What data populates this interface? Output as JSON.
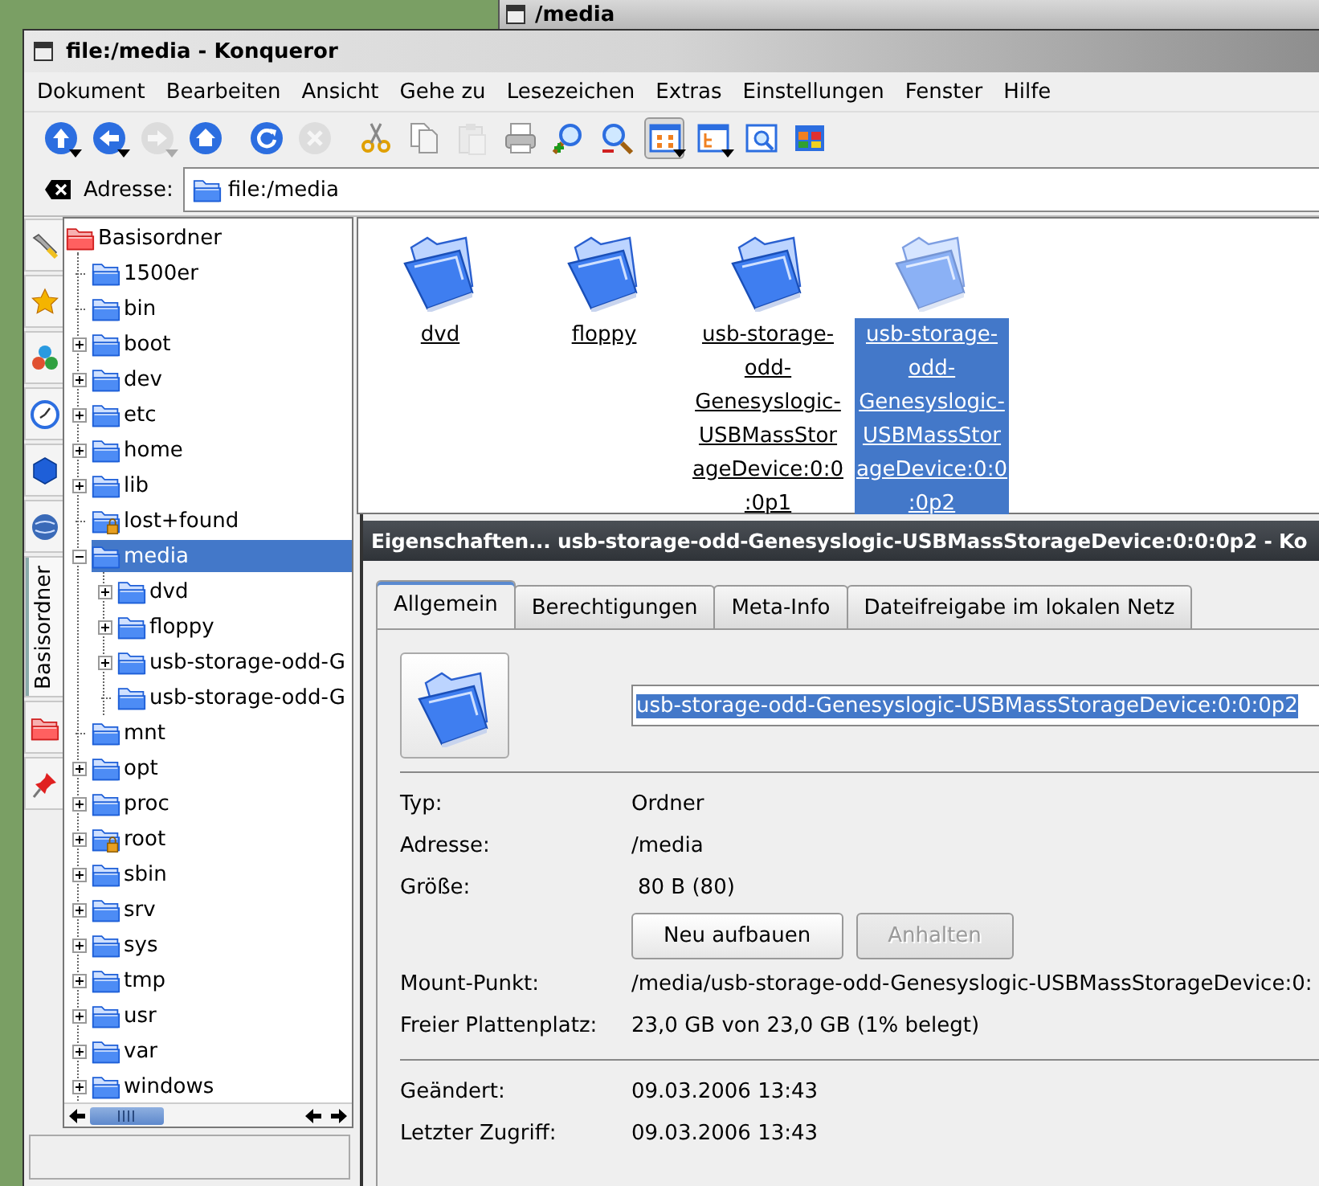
{
  "background_window": {
    "title": "/media"
  },
  "window": {
    "title": "file:/media - Konqueror"
  },
  "menu": [
    "Dokument",
    "Bearbeiten",
    "Ansicht",
    "Gehe zu",
    "Lesezeichen",
    "Extras",
    "Einstellungen",
    "Fenster",
    "Hilfe"
  ],
  "toolbar": [
    {
      "kind": "up",
      "dropdown": true,
      "disabled": false,
      "pressed": false
    },
    {
      "kind": "back",
      "dropdown": true,
      "disabled": false,
      "pressed": false
    },
    {
      "kind": "forward",
      "dropdown": true,
      "disabled": true,
      "pressed": false
    },
    {
      "kind": "home",
      "dropdown": false,
      "disabled": false,
      "pressed": false
    },
    {
      "kind": "reload",
      "dropdown": false,
      "disabled": false,
      "pressed": false
    },
    {
      "kind": "stop",
      "dropdown": false,
      "disabled": true,
      "pressed": false
    },
    {
      "kind": "cut",
      "dropdown": false,
      "disabled": false,
      "pressed": false
    },
    {
      "kind": "copy",
      "dropdown": false,
      "disabled": false,
      "pressed": false
    },
    {
      "kind": "paste",
      "dropdown": false,
      "disabled": true,
      "pressed": false
    },
    {
      "kind": "print",
      "dropdown": false,
      "disabled": false,
      "pressed": false
    },
    {
      "kind": "zoom-in",
      "dropdown": false,
      "disabled": false,
      "pressed": false
    },
    {
      "kind": "zoom-out",
      "dropdown": false,
      "disabled": false,
      "pressed": false
    },
    {
      "kind": "icon-view",
      "dropdown": true,
      "disabled": false,
      "pressed": true
    },
    {
      "kind": "tree-view",
      "dropdown": true,
      "disabled": false,
      "pressed": false
    },
    {
      "kind": "preview",
      "dropdown": false,
      "disabled": false,
      "pressed": false
    },
    {
      "kind": "color-grid",
      "dropdown": false,
      "disabled": false,
      "pressed": false
    }
  ],
  "address": {
    "label": "Adresse:",
    "value": "file:/media"
  },
  "sidebar_tabs": [
    {
      "kind": "wrench",
      "selected": false
    },
    {
      "kind": "star",
      "selected": false
    },
    {
      "kind": "balls",
      "selected": false
    },
    {
      "kind": "clock",
      "selected": false
    },
    {
      "kind": "cube",
      "selected": false
    },
    {
      "kind": "globe",
      "selected": false
    },
    {
      "kind": "text",
      "label": "Basisordner",
      "selected": true
    },
    {
      "kind": "red-folder",
      "selected": false
    },
    {
      "kind": "pin",
      "selected": false
    }
  ],
  "tree": {
    "label": "Basisordner",
    "kind": "root",
    "selected": false,
    "children": [
      {
        "label": "1500er",
        "selected": false
      },
      {
        "label": "bin",
        "selected": false
      },
      {
        "label": "boot",
        "expanded": false,
        "selected": false
      },
      {
        "label": "dev",
        "expanded": false,
        "selected": false
      },
      {
        "label": "etc",
        "expanded": false,
        "selected": false
      },
      {
        "label": "home",
        "expanded": false,
        "selected": false
      },
      {
        "label": "lib",
        "expanded": false,
        "selected": false
      },
      {
        "label": "lost+found",
        "locked": true,
        "selected": false
      },
      {
        "label": "media",
        "expanded": true,
        "selected": true,
        "children": [
          {
            "label": "dvd",
            "expanded": false,
            "selected": false
          },
          {
            "label": "floppy",
            "expanded": false,
            "selected": false
          },
          {
            "label": "usb-storage-odd-G",
            "expanded": false,
            "selected": false
          },
          {
            "label": "usb-storage-odd-G",
            "selected": false
          }
        ]
      },
      {
        "label": "mnt",
        "selected": false
      },
      {
        "label": "opt",
        "expanded": false,
        "selected": false
      },
      {
        "label": "proc",
        "expanded": false,
        "selected": false
      },
      {
        "label": "root",
        "expanded": false,
        "locked": true,
        "selected": false
      },
      {
        "label": "sbin",
        "expanded": false,
        "selected": false
      },
      {
        "label": "srv",
        "expanded": false,
        "selected": false
      },
      {
        "label": "sys",
        "expanded": false,
        "selected": false
      },
      {
        "label": "tmp",
        "expanded": false,
        "selected": false
      },
      {
        "label": "usr",
        "expanded": false,
        "selected": false
      },
      {
        "label": "var",
        "expanded": false,
        "selected": false
      },
      {
        "label": "windows",
        "expanded": false,
        "selected": false
      }
    ]
  },
  "icons": [
    {
      "label": "dvd",
      "selected": false
    },
    {
      "label": "floppy",
      "selected": false
    },
    {
      "label": "usb-storage-odd-Genesyslogic-USBMassStorageDevice:0:0:0p1",
      "selected": false
    },
    {
      "label": "usb-storage-odd-Genesyslogic-USBMassStorageDevice:0:0:0p2",
      "selected": true
    }
  ],
  "dialog": {
    "title": "Eigenschaften... usb-storage-odd-Genesyslogic-USBMassStorageDevice:0:0:0p2 - Ko",
    "tabs": [
      {
        "label": "Allgemein",
        "selected": true
      },
      {
        "label": "Berechtigungen",
        "selected": false
      },
      {
        "label": "Meta-Info",
        "selected": false
      },
      {
        "label": "Dateifreigabe im lokalen Netz",
        "selected": false
      }
    ],
    "name_value": "usb-storage-odd-Genesyslogic-USBMassStorageDevice:0:0:0p2",
    "info": [
      {
        "label": "Typ:",
        "value": "Ordner"
      },
      {
        "label": "Adresse:",
        "value": "/media"
      },
      {
        "label": "Größe:",
        "value": "80 B (80)"
      }
    ],
    "size_buttons": [
      {
        "label": "Neu aufbauen",
        "disabled": false
      },
      {
        "label": "Anhalten",
        "disabled": true
      }
    ],
    "mount_info": [
      {
        "label": "Mount-Punkt:",
        "value": "/media/usb-storage-odd-Genesyslogic-USBMassStorageDevice:0:"
      },
      {
        "label": "Freier Plattenplatz:",
        "value": "23,0 GB von 23,0 GB (1% belegt)"
      }
    ],
    "dates": [
      {
        "label": "Geändert:",
        "value": "09.03.2006 13:43"
      },
      {
        "label": "Letzter Zugriff:",
        "value": "09.03.2006 13:43"
      }
    ]
  }
}
